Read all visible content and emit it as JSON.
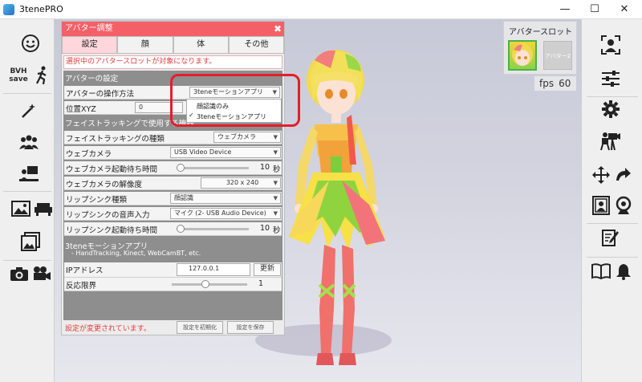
{
  "window": {
    "title": "3tenePRO",
    "minimize": "—",
    "maximize": "☐",
    "close": "✕"
  },
  "avatar_slot": {
    "title": "アバタースロット",
    "slot2_label": "アバター2"
  },
  "fps": {
    "label": "fps",
    "value": "60"
  },
  "panel": {
    "title": "アバター調整",
    "close": "✖",
    "tabs": [
      "設定",
      "顔",
      "体",
      "その他"
    ],
    "notice": "選択中のアバタースロットが対象になります。",
    "avatar_settings": {
      "header": "アバターの設定",
      "operation_label": "アバターの操作方法",
      "operation_value": "3teneモーションアプリ",
      "position_label": "位置XYZ",
      "position_x": "0",
      "position_y": "0"
    },
    "face_tracking": {
      "header": "フェイストラッキングで使用する機器",
      "type_label": "フェイストラッキングの種類",
      "type_value": "ウェブカメラ",
      "webcam_label": "ウェブカメラ",
      "webcam_value": "USB Video Device",
      "wait_label": "ウェブカメラ起動待ち時間",
      "wait_value": "10",
      "wait_unit": "秒",
      "wait_fraction": 0.05,
      "resolution_label": "ウェブカメラの解像度",
      "resolution_value": "320 x 240",
      "lipsync_type_label": "リップシンク種類",
      "lipsync_type_value": "顔認識",
      "lipsync_input_label": "リップシンクの音声入力",
      "lipsync_input_value": "マイク (2- USB Audio Device)",
      "lipsync_wait_label": "リップシンク起動待ち時間",
      "lipsync_wait_value": "10",
      "lipsync_wait_unit": "秒"
    },
    "motion_app": {
      "header": "3teneモーションアプリ",
      "subtitle": "- HandTracking, Kinect, WebCamBT, etc.",
      "ip_label": "IPアドレス",
      "ip_value": "127.0.0.1",
      "update_button": "更新",
      "threshold_label": "反応限界",
      "threshold_value": "1",
      "threshold_fraction": 0.45
    },
    "dropdown": {
      "options": [
        "顔認識のみ",
        "3teneモーションアプリ"
      ],
      "selected_mark": "✓"
    },
    "footer": {
      "change_message": "設定が変更されています。",
      "reset_button": "設定を初期化",
      "save_button": "設定を保存"
    }
  },
  "left_toolbar": {
    "bvh_label": "BVH",
    "save_label": "save"
  }
}
